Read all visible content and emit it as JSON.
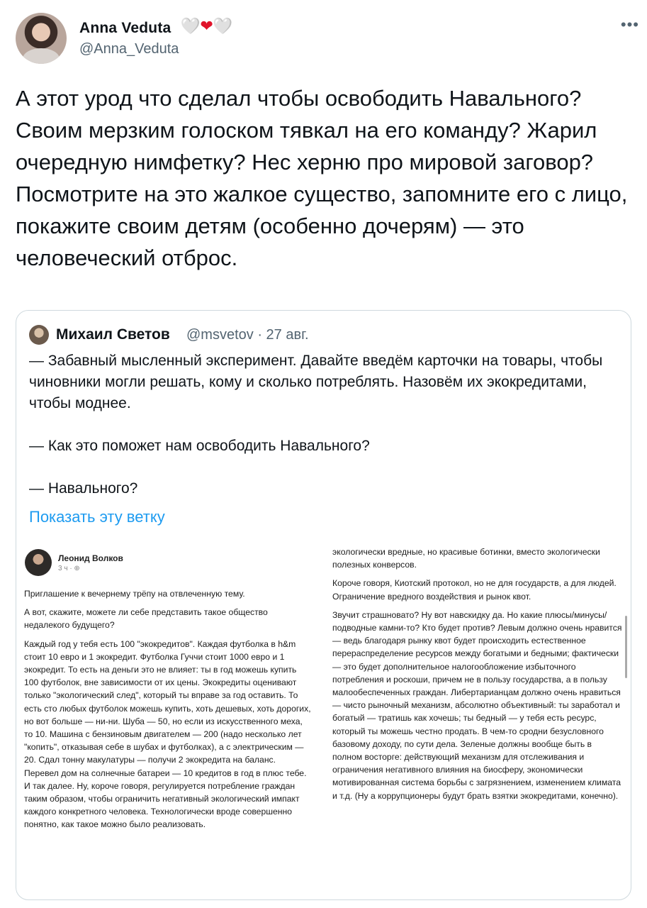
{
  "author": {
    "name": "Anna Veduta",
    "hearts": [
      "🤍",
      "❤",
      "🤍"
    ],
    "handle": "@Anna_Veduta"
  },
  "more_icon": "•••",
  "tweet_text": "А  этот урод что сделал чтобы освободить Навального? Своим мерзким голоском тявкал на его команду? Жарил очередную нимфетку? Нес херню про мировой заговор? Посмотрите на это жалкое существо, запомните его с лицо, покажите своим детям (особенно дочерям) — это человеческий отброс.",
  "quote": {
    "name": "Михаил Светов",
    "meta": "@msvetov · 27 авг.",
    "paragraphs": [
      "— Забавный мысленный эксперимент. Давайте введём карточки на товары, чтобы чиновники могли решать, кому и сколько потреблять. Назовём их экокредитами, чтобы моднее.",
      "— Как это поможет нам освободить Навального?",
      "— Навального?"
    ],
    "show_thread": "Показать эту ветку"
  },
  "embedded_post": {
    "name": "Леонид Волков",
    "meta": "3 ч · ⊕",
    "left_paragraphs": [
      "Приглашение к вечернему трёпу на отвлеченную тему.",
      "А вот, скажите, можете ли себе представить такое общество недалекого будущего?",
      "Каждый год у тебя есть 100 \"экокредитов\". Каждая футболка в h&m стоит 10 евро и 1 экокредит. Футболка Гуччи стоит 1000 евро и 1 экокредит. То есть на деньги это не влияет: ты в год можешь купить 100 футболок, вне зависимости от их цены. Экокредиты оценивают только \"экологический след\", который ты вправе за год оставить. То есть сто любых футболок можешь купить, хоть дешевых, хоть дорогих, но вот больше — ни-ни. Шуба — 50, но если из искусственного меха, то 10. Машина с бензиновым двигателем — 200 (надо несколько лет \"копить\", отказывая себе в шубах и футболках), а с электрическим — 20. Сдал тонну макулатуры — получи 2 экокредита на баланс. Перевел дом на солнечные батареи — 10 кредитов в год в плюс тебе. И так далее. Ну, короче говоря, регулируется потребление граждан таким образом, чтобы ограничить негативный экологический импакт каждого конкретного человека. Технологически вроде совершенно понятно, как такое можно было реализовать."
    ],
    "right_paragraphs": [
      "экологически вредные, но красивые ботинки, вместо экологически полезных конверсов.",
      "Короче говоря, Киотский протокол, но не для государств, а для людей. Ограничение вредного воздействия и рынок квот.",
      "Звучит страшновато? Ну вот навскидку да. Но какие плюсы/минусы/подводные камни-то? Кто будет против? Левым должно очень нравится — ведь благодаря рынку квот будет происходить естественное перераспределение ресурсов между богатыми и бедными; фактически — это будет дополнительное налогообложение избыточного потребления и роскоши, причем не в пользу государства, а в пользу малообеспеченных граждан. Либертарианцам должно очень нравиться — чисто рыночный механизм, абсолютно объективный: ты заработал и богатый — тратишь как хочешь; ты бедный — у тебя есть ресурс, который ты можешь честно продать. В чем-то сродни безусловного базовому доходу, по сути дела. Зеленые должны вообще быть в полном восторге: действующий механизм для отслеживания и ограничения негативного влияния на биосферу, экономически мотивированная система борьбы с загрязнением, изменением климата и т.д. (Ну а коррупционеры будут брать взятки экокредитами, конечно)."
    ]
  }
}
